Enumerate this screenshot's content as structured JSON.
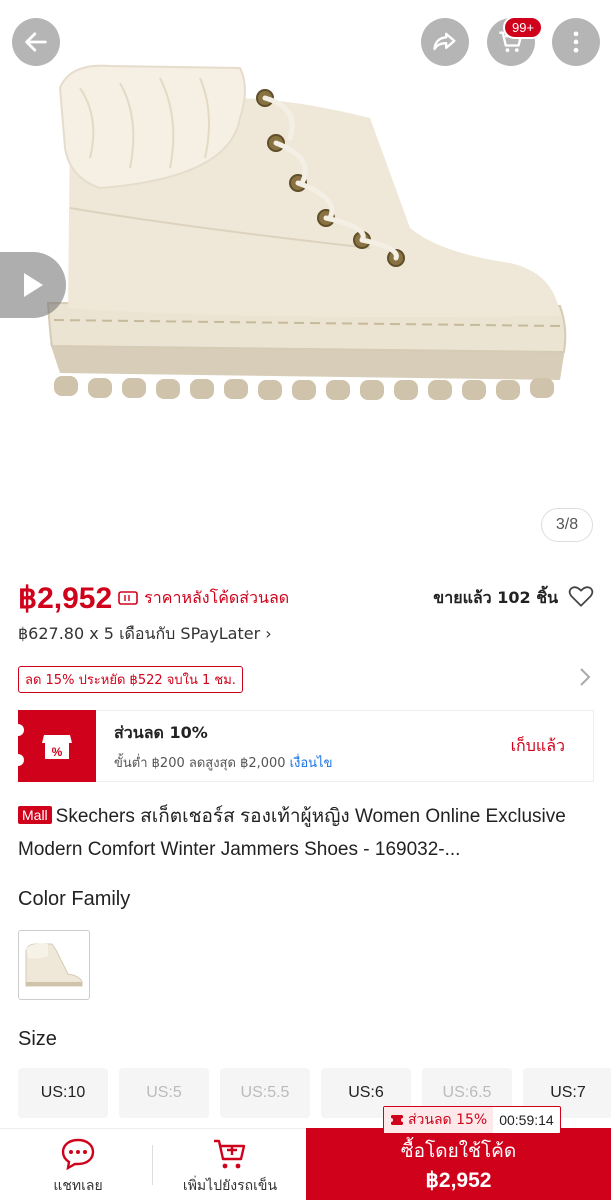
{
  "hero": {
    "cart_badge": "99+",
    "page_counter": "3/8"
  },
  "price": {
    "amount": "฿2,952",
    "note": "ราคาหลังโค้ดส่วนลด",
    "sold": "ขายแล้ว 102 ชิ้น"
  },
  "installment": "฿627.80 x 5 เดือนกับ SPayLater ›",
  "promo_tag": "ลด 15% ประหยัด ฿522 จบใน 1 ชม.",
  "voucher": {
    "title": "ส่วนลด 10%",
    "subtitle": "ขั้นต่ำ ฿200 ลดสูงสุด ฿2,000",
    "condition": "เงื่อนไข",
    "action": "เก็บแล้ว"
  },
  "product": {
    "mall_badge": "Mall",
    "title": "Skechers สเก็ตเชอร์ส รองเท้าผู้หญิง Women Online Exclusive Modern Comfort Winter Jammers Shoes - 169032-..."
  },
  "color_family": {
    "label": "Color Family"
  },
  "size": {
    "label": "Size",
    "options": [
      "US:10",
      "US:5",
      "US:5.5",
      "US:6",
      "US:6.5",
      "US:7"
    ]
  },
  "countdown": {
    "label": "ส่วนลด 15%",
    "time": "00:59:14"
  },
  "bottom_bar": {
    "chat_label": "แชทเลย",
    "cart_label": "เพิ่มไปยังรถเข็น",
    "buy_label": "ซื้อโดยใช้โค้ด",
    "buy_price": "฿2,952"
  },
  "colors": {
    "accent": "#d0021b",
    "link": "#1a73e8"
  }
}
